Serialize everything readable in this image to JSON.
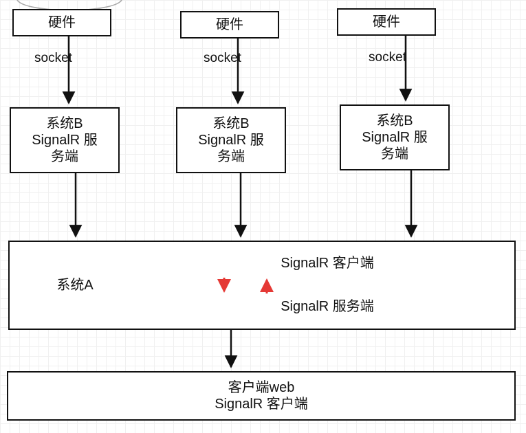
{
  "diagram": {
    "hardware": "硬件",
    "socketLabel": "socket",
    "systemB_line1": "系统B",
    "systemB_line2": "SignalR 服",
    "systemB_line3": "务端",
    "systemA": "系统A",
    "signalR_client": "SignalR 客户端",
    "signalR_server": "SignalR 服务端",
    "webClient_line1": "客户端web",
    "webClient_line2": "SignalR 客户端",
    "colors": {
      "stroke": "#111111",
      "redArrow": "#e53935"
    }
  }
}
